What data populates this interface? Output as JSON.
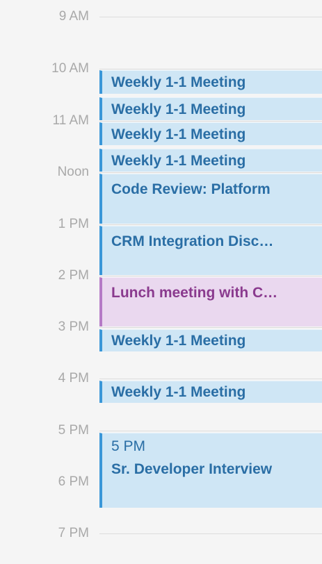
{
  "hours": [
    "9 AM",
    "10 AM",
    "11 AM",
    "Noon",
    "1 PM",
    "2 PM",
    "3 PM",
    "4 PM",
    "5 PM",
    "6 PM",
    "7 PM"
  ],
  "events": [
    {
      "title": "Weekly 1-1 Meeting",
      "color": "#3a97d8"
    },
    {
      "title": "Weekly 1-1 Meeting",
      "color": "#3a97d8"
    },
    {
      "title": "Weekly 1-1 Meeting",
      "color": "#3a97d8"
    },
    {
      "title": "Weekly 1-1 Meeting",
      "color": "#3a97d8"
    },
    {
      "title": "Code Review: Platform",
      "color": "#3a97d8"
    },
    {
      "title": "CRM Integration Disc…",
      "color": "#3a97d8"
    },
    {
      "title": "Lunch meeting with C…",
      "color": "#b57ac6"
    },
    {
      "title": "Weekly 1-1 Meeting",
      "color": "#3a97d8"
    },
    {
      "title": "Weekly 1-1 Meeting",
      "color": "#3a97d8"
    },
    {
      "time": "5 PM",
      "title": "Sr. Developer Interview",
      "color": "#3a97d8"
    }
  ]
}
